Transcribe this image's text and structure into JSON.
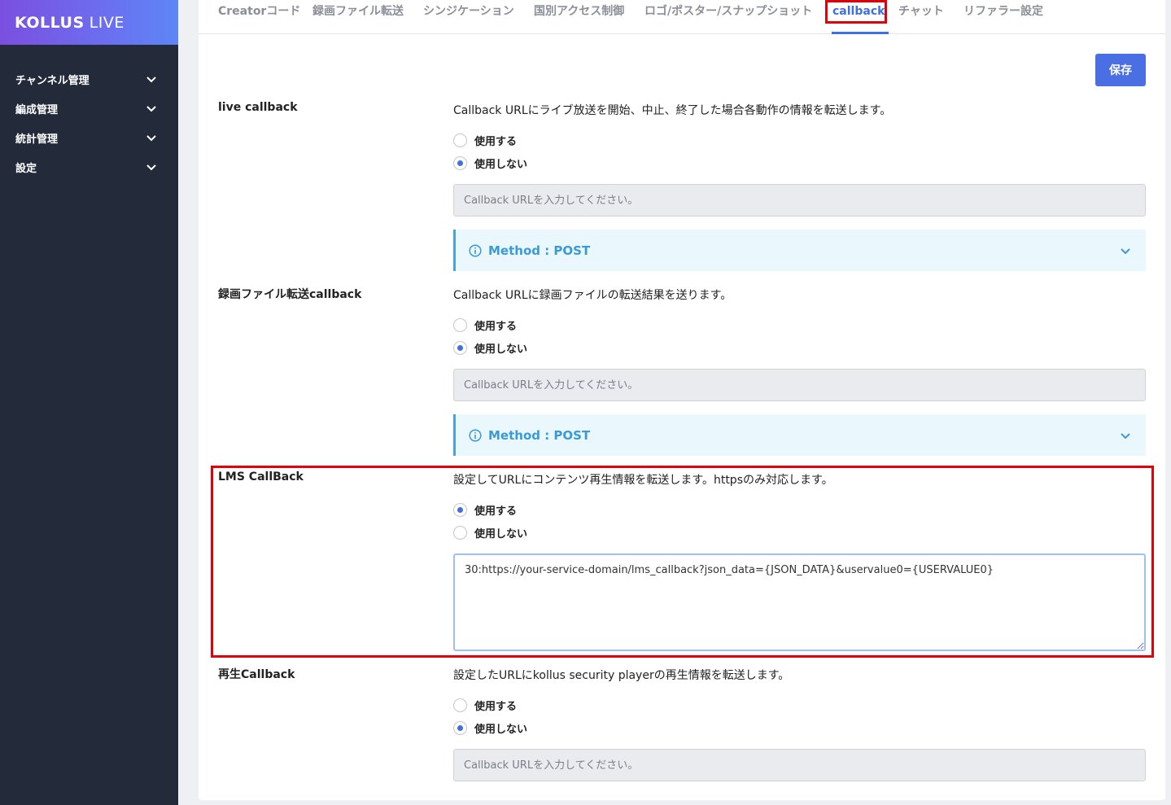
{
  "sidebar": {
    "logo_bold": "KOLLUS",
    "logo_light": "LIVE",
    "items": [
      {
        "label": "チャンネル管理"
      },
      {
        "label": "編成管理"
      },
      {
        "label": "統計管理"
      },
      {
        "label": "設定"
      }
    ]
  },
  "tabs": [
    {
      "label": "Creatorコード"
    },
    {
      "label": "録画ファイル転送"
    },
    {
      "label": "シンジケーション"
    },
    {
      "label": "国別アクセス制御"
    },
    {
      "label": "ロゴ/ポスター/スナップショット"
    },
    {
      "label": "callback",
      "active": true
    },
    {
      "label": "チャット"
    },
    {
      "label": "リファラー設定"
    }
  ],
  "save_label": "保存",
  "sections": [
    {
      "title": "live callback",
      "desc": "Callback URLにライブ放送を開始、中止、終了した場合各動作の情報を転送します。",
      "opt_use": "使用する",
      "opt_nouse": "使用しない",
      "selected": "nouse",
      "placeholder": "Callback URLを入力してください。",
      "method": "Method : POST"
    },
    {
      "title": "録画ファイル転送callback",
      "desc": "Callback URLに録画ファイルの転送結果を送ります。",
      "opt_use": "使用する",
      "opt_nouse": "使用しない",
      "selected": "nouse",
      "placeholder": "Callback URLを入力してください。",
      "method": "Method : POST"
    },
    {
      "title": "LMS CallBack",
      "desc": "設定してURLにコンテンツ再生情報を転送します。httpsのみ対応します。",
      "opt_use": "使用する",
      "opt_nouse": "使用しない",
      "selected": "use",
      "value": "30:https://your-service-domain/lms_callback?json_data={JSON_DATA}&uservalue0={USERVALUE0}"
    },
    {
      "title": "再生Callback",
      "desc": "設定したURLにkollus security playerの再生情報を転送します。",
      "opt_use": "使用する",
      "opt_nouse": "使用しない",
      "selected": "nouse",
      "placeholder": "Callback URLを入力してください。"
    }
  ],
  "colors": {
    "accent": "#3f6fe0",
    "highlight": "#e0000a",
    "sidebar_bg": "#232b3b",
    "info": "#3a9ad6"
  }
}
